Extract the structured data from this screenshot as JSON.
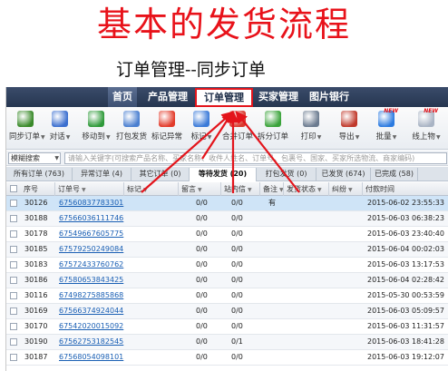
{
  "title": "基本的发货流程",
  "subtitle": "订单管理--同步订单",
  "nav": {
    "items": [
      {
        "label": "首页"
      },
      {
        "label": "产品管理"
      },
      {
        "label": "订单管理"
      },
      {
        "label": "买家管理"
      },
      {
        "label": "图片银行"
      }
    ],
    "active": "订单管理"
  },
  "toolbar": {
    "items": [
      {
        "label": "同步订单",
        "icon": "sync-order-icon",
        "color": "#3a8a2a",
        "dropdown": true
      },
      {
        "label": "对话",
        "icon": "chat-icon",
        "color": "#3b6fcf",
        "dropdown": true
      },
      {
        "label": "移动到",
        "icon": "move-to-icon",
        "color": "#2f9a3a",
        "dropdown": true
      },
      {
        "label": "打包发货",
        "icon": "pack-ship-icon",
        "color": "#4a7fd0",
        "dropdown": false
      },
      {
        "label": "标记异常",
        "icon": "flag-red-icon",
        "color": "#e23b2a",
        "dropdown": false
      },
      {
        "label": "标记",
        "icon": "flag-blue-icon",
        "color": "#3a7ad8",
        "dropdown": true
      },
      {
        "label": "合并订单",
        "icon": "merge-order-icon",
        "color": "#d93a2e",
        "dropdown": false
      },
      {
        "label": "拆分订单",
        "icon": "split-order-icon",
        "color": "#3aa33a",
        "dropdown": false
      },
      {
        "label": "打印",
        "icon": "printer-icon",
        "color": "#6b7b8f",
        "dropdown": true
      },
      {
        "label": "导出",
        "icon": "export-icon",
        "color": "#c0392b",
        "dropdown": true
      },
      {
        "label": "批量",
        "icon": "batch-icon",
        "color": "#2c7be0",
        "dropdown": true,
        "badge": "NEW"
      },
      {
        "label": "线上物",
        "icon": "online-logistics-icon",
        "color": "#a9b4c4",
        "dropdown": true,
        "badge": "NEW"
      }
    ]
  },
  "filter": {
    "mode": "模糊搜索",
    "placeholder": "请输入关键字(可搜索产品名称、买家名称、收件人姓名、订单号、包裹号、国家、买家所选物流、商家编码)"
  },
  "tabs": [
    {
      "label": "所有订单 (763)"
    },
    {
      "label": "异常订单 (4)"
    },
    {
      "label": "其它订单 (0)"
    },
    {
      "label": "等待发货 (20)"
    },
    {
      "label": "打包发货 (0)"
    },
    {
      "label": "已发货 (674)"
    },
    {
      "label": "已完成 (58)"
    }
  ],
  "columns": [
    "序号",
    "订单号",
    "标记",
    "留言",
    "站内信",
    "备注",
    "发货状态",
    "纠纷",
    "付款时间"
  ],
  "rows": [
    {
      "seq": "30126",
      "order": "67560837783301",
      "msg": "0/0",
      "inbox": "0/0",
      "note": "有",
      "paid": "2015-06-02 23:55:33",
      "selected": true
    },
    {
      "seq": "30188",
      "order": "67566036111746",
      "msg": "0/0",
      "inbox": "0/0",
      "note": "",
      "paid": "2015-06-03 06:38:23"
    },
    {
      "seq": "30178",
      "order": "67549667605775",
      "msg": "0/0",
      "inbox": "0/0",
      "note": "",
      "paid": "2015-06-03 23:40:40"
    },
    {
      "seq": "30185",
      "order": "67579250249084",
      "msg": "0/0",
      "inbox": "0/0",
      "note": "",
      "paid": "2015-06-04 00:02:03"
    },
    {
      "seq": "30183",
      "order": "67572433760762",
      "msg": "0/0",
      "inbox": "0/0",
      "note": "",
      "paid": "2015-06-03 13:17:53"
    },
    {
      "seq": "30186",
      "order": "67580653843425",
      "msg": "0/0",
      "inbox": "0/0",
      "note": "",
      "paid": "2015-06-04 02:28:42"
    },
    {
      "seq": "30116",
      "order": "67498275885868",
      "msg": "0/0",
      "inbox": "0/0",
      "note": "",
      "paid": "2015-05-30 00:53:59"
    },
    {
      "seq": "30169",
      "order": "67566374924044",
      "msg": "0/0",
      "inbox": "0/0",
      "note": "",
      "paid": "2015-06-03 05:09:57"
    },
    {
      "seq": "30170",
      "order": "67542020015092",
      "msg": "0/0",
      "inbox": "0/0",
      "note": "",
      "paid": "2015-06-03 11:31:57"
    },
    {
      "seq": "30190",
      "order": "67562753182545",
      "msg": "0/0",
      "inbox": "0/1",
      "note": "",
      "paid": "2015-06-03 18:41:28"
    },
    {
      "seq": "30187",
      "order": "67568054098101",
      "msg": "0/0",
      "inbox": "0/0",
      "note": "",
      "paid": "2015-06-03 19:12:07"
    }
  ],
  "colors": {
    "title_red": "#e8121a",
    "annotation_red": "#e3141b",
    "nav_bg": "#263650",
    "link_blue": "#1a5fb4",
    "selected_row": "#cfe4f7"
  }
}
